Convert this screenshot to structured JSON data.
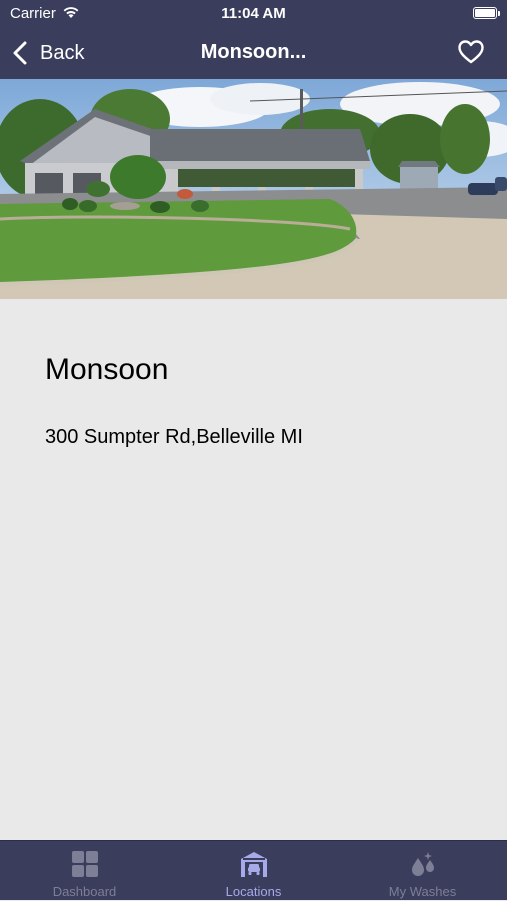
{
  "status_bar": {
    "carrier": "Carrier",
    "time": "11:04 AM"
  },
  "nav": {
    "back_label": "Back",
    "title": "Monsoon..."
  },
  "location": {
    "name": "Monsoon",
    "address": "300 Sumpter Rd,Belleville MI"
  },
  "tabs": [
    {
      "label": "Dashboard",
      "icon": "dashboard-grid-icon",
      "active": false
    },
    {
      "label": "Locations",
      "icon": "car-wash-building-icon",
      "active": true
    },
    {
      "label": "My Washes",
      "icon": "water-drops-icon",
      "active": false
    }
  ],
  "colors": {
    "bar": "#3b3d5c",
    "active_tab": "#a7aae8",
    "inactive_tab": "#7d7f96",
    "content_bg": "#e9e9e9"
  }
}
